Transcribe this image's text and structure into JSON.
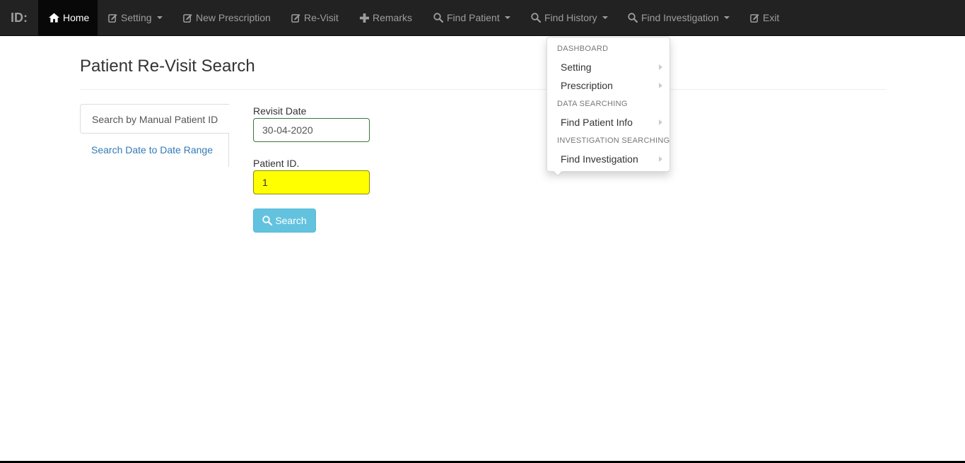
{
  "navbar": {
    "brand": "ID:",
    "items": [
      {
        "label": "Home",
        "icon": "home-icon",
        "active": true
      },
      {
        "label": "Setting",
        "icon": "edit-icon",
        "caret": true
      },
      {
        "label": "New Prescription",
        "icon": "edit-icon"
      },
      {
        "label": "Re-Visit",
        "icon": "edit-icon"
      },
      {
        "label": "Remarks",
        "icon": "plus-icon"
      },
      {
        "label": "Find Patient",
        "icon": "search-icon",
        "caret": true
      },
      {
        "label": "Find History",
        "icon": "search-icon",
        "caret": true
      },
      {
        "label": "Find Investigation",
        "icon": "search-icon",
        "caret": true
      },
      {
        "label": "Exit",
        "icon": "edit-icon"
      }
    ]
  },
  "page": {
    "title": "Patient Re-Visit Search"
  },
  "tabs": {
    "manual": "Search by Manual Patient ID",
    "range": "Search Date to Date Range"
  },
  "form": {
    "revisit_date_label": "Revisit Date",
    "revisit_date_value": "30-04-2020",
    "patient_id_label": "Patient ID.",
    "patient_id_value": "1",
    "search_label": "Search"
  },
  "dropdown": {
    "header_dashboard": "DASHBOARD",
    "setting": "Setting",
    "prescription": "Prescription",
    "header_data": "DATA SEARCHING",
    "find_patient_info": "Find Patient Info",
    "header_investigation": "INVESTIGATION SEARCHING",
    "find_investigation": "Find Investigation"
  },
  "colors": {
    "navbar_bg": "#222222",
    "active_bg": "#080808",
    "link": "#337ab7",
    "button": "#5bc0de",
    "highlight": "#ffff00"
  }
}
